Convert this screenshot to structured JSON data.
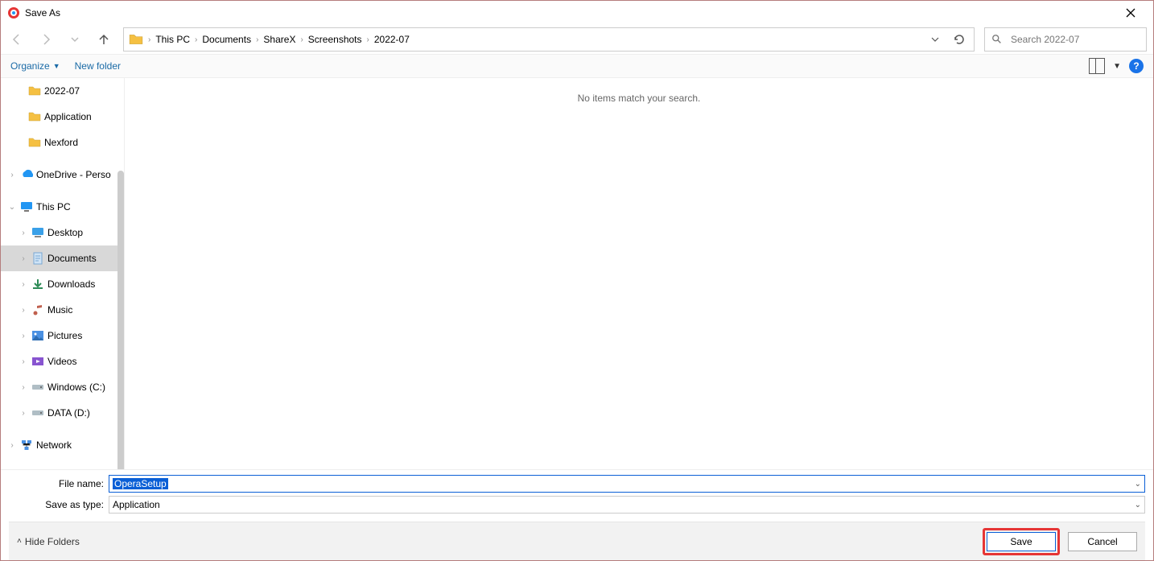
{
  "title": "Save As",
  "breadcrumb": [
    "This PC",
    "Documents",
    "ShareX",
    "Screenshots",
    "2022-07"
  ],
  "search_placeholder": "Search 2022-07",
  "toolbar": {
    "organize": "Organize",
    "newfolder": "New folder",
    "help": "?"
  },
  "tree": {
    "items": [
      {
        "label": "2022-07",
        "icon": "folder",
        "indent": "indent1",
        "expand": ""
      },
      {
        "label": "Application",
        "icon": "folder",
        "indent": "indent1",
        "expand": ""
      },
      {
        "label": "Nexford",
        "icon": "folder",
        "indent": "indent1",
        "expand": ""
      },
      {
        "label": "OneDrive - Perso",
        "icon": "cloud",
        "indent": "",
        "expand": "›"
      },
      {
        "label": "This PC",
        "icon": "pc",
        "indent": "",
        "expand": "⌄"
      },
      {
        "label": "Desktop",
        "icon": "desktop",
        "indent": "indent2",
        "expand": "›"
      },
      {
        "label": "Documents",
        "icon": "doc",
        "indent": "indent2",
        "expand": "›",
        "selected": true
      },
      {
        "label": "Downloads",
        "icon": "download",
        "indent": "indent2",
        "expand": "›"
      },
      {
        "label": "Music",
        "icon": "music",
        "indent": "indent2",
        "expand": "›"
      },
      {
        "label": "Pictures",
        "icon": "pictures",
        "indent": "indent2",
        "expand": "›"
      },
      {
        "label": "Videos",
        "icon": "videos",
        "indent": "indent2",
        "expand": "›"
      },
      {
        "label": "Windows (C:)",
        "icon": "drive",
        "indent": "indent2",
        "expand": "›"
      },
      {
        "label": "DATA (D:)",
        "icon": "drive",
        "indent": "indent2",
        "expand": "›"
      },
      {
        "label": "Network",
        "icon": "network",
        "indent": "",
        "expand": "›"
      }
    ]
  },
  "main_empty": "No items match your search.",
  "labels": {
    "filename": "File name:",
    "savetype": "Save as type:"
  },
  "filename_value": "OperaSetup",
  "savetype_value": "Application",
  "hide_folders": "Hide Folders",
  "buttons": {
    "save": "Save",
    "cancel": "Cancel"
  }
}
